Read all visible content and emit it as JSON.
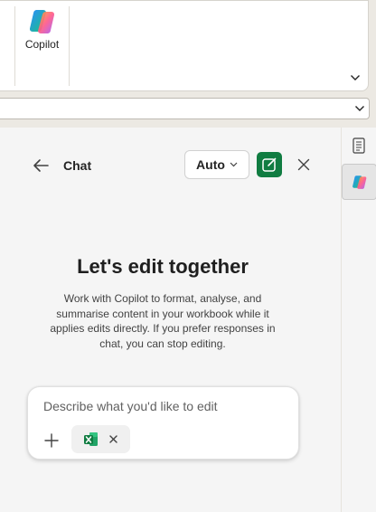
{
  "ribbon": {
    "copilot_label": "Copilot",
    "copilot_icon": "copilot-icon",
    "expand_icon": "chevron-down-icon"
  },
  "formula_bar": {
    "value": "",
    "expand_icon": "chevron-down-icon"
  },
  "rail": {
    "items": [
      {
        "icon": "document-icon"
      },
      {
        "icon": "copilot-icon",
        "active": true
      }
    ]
  },
  "pane": {
    "title": "Chat",
    "back_icon": "arrow-left-icon",
    "mode_label": "Auto",
    "mode_icon": "chevron-down-icon",
    "new_chat_icon": "compose-icon",
    "close_icon": "close-icon"
  },
  "empty_state": {
    "heading": "Let's edit together",
    "description": "Work with Copilot to format, analyse, and summarise content in your workbook while it applies edits directly. If you prefer responses in chat, you can stop editing."
  },
  "composer": {
    "placeholder": "Describe what you'd like to edit",
    "value": "",
    "add_icon": "plus-icon",
    "attachment_icon": "excel-icon",
    "remove_icon": "close-icon"
  },
  "colors": {
    "accent": "#107c41",
    "pane_background": "#f5f5f5",
    "app_background": "#ece9e3"
  }
}
